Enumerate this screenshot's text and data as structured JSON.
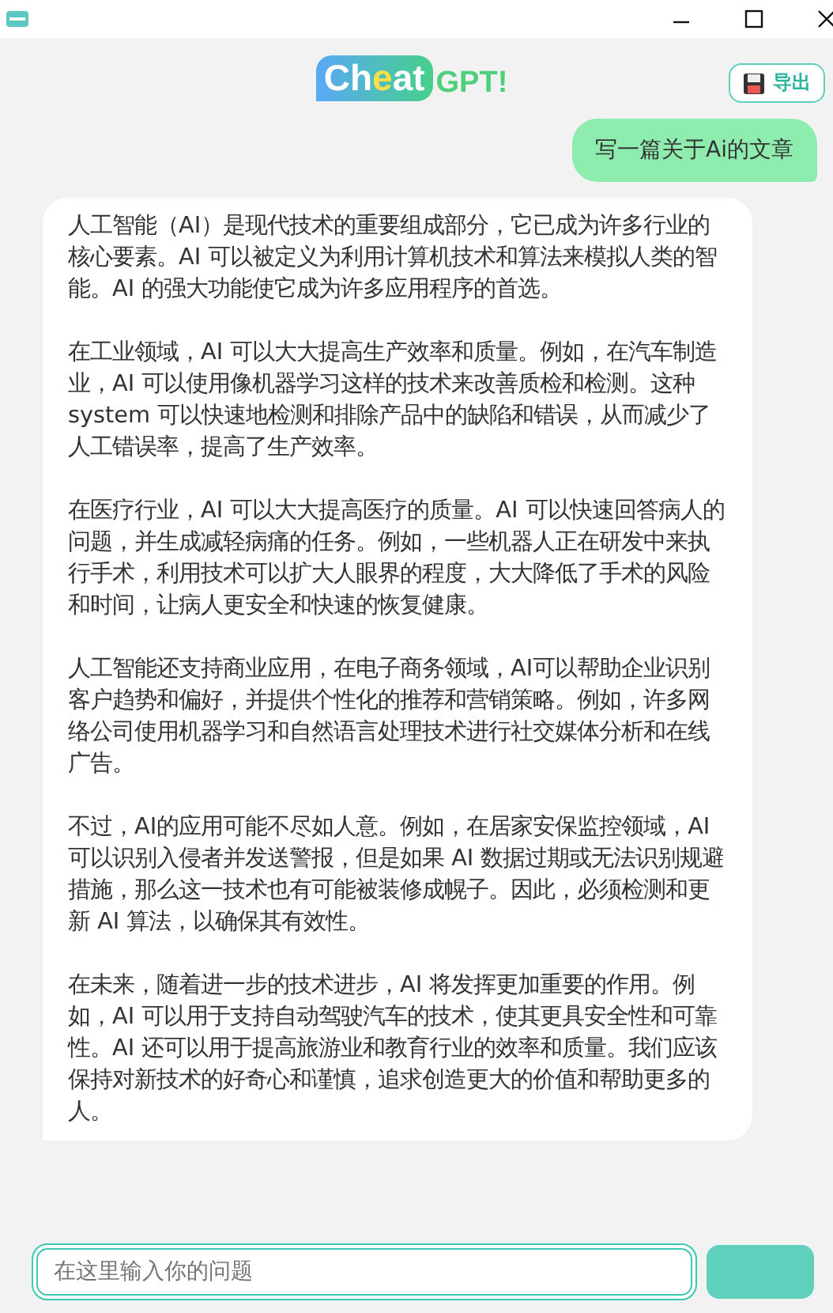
{
  "logo": {
    "segments": [
      {
        "text": "Ch",
        "color": "#ffffff"
      },
      {
        "text": "e",
        "color": "#f7e04a"
      },
      {
        "text": "at",
        "color": "#ffffff"
      }
    ],
    "suffix": "GPT!"
  },
  "export_button": {
    "label": "导出"
  },
  "messages": [
    {
      "kind": "user",
      "paragraphs": [
        "写一篇关于Ai的文章"
      ]
    },
    {
      "kind": "reply",
      "paragraphs": [
        "人工智能（AI）是现代技术的重要组成部分，它已成为许多行业的核心要素。AI 可以被定义为利用计算机技术和算法来模拟人类的智能。AI 的强大功能使它成为许多应用程序的首选。",
        "在工业领域，AI 可以大大提高生产效率和质量。例如，在汽车制造业，AI 可以使用像机器学习这样的技术来改善质检和检测。这种 system 可以快速地检测和排除产品中的缺陷和错误，从而减少了人工错误率，提高了生产效率。",
        "在医疗行业，AI 可以大大提高医疗的质量。AI 可以快速回答病人的问题，并生成减轻病痛的任务。例如，一些机器人正在研发中来执行手术，利用技术可以扩大人眼界的程度，大大降低了手术的风险和时间，让病人更安全和快速的恢复健康。",
        "人工智能还支持商业应用，在电子商务领域，AI可以帮助企业识别客户趋势和偏好，并提供个性化的推荐和营销策略。例如，许多网络公司使用机器学习和自然语言处理技术进行社交媒体分析和在线广告。",
        "不过，AI的应用可能不尽如人意。例如，在居家安保监控领域，AI 可以识别入侵者并发送警报，但是如果 AI 数据过期或无法识别规避措施，那么这一技术也有可能被装修成幌子。因此，必须检测和更新 AI 算法，以确保其有效性。",
        "在未来，随着进一步的技术进步，AI 将发挥更加重要的作用。例如，AI 可以用于支持自动驾驶汽车的技术，使其更具安全性和可靠性。AI 还可以用于提高旅游业和教育行业的效率和质量。我们应该保持对新技术的好奇心和谨慎，追求创造更大的价值和帮助更多的人。"
      ]
    }
  ],
  "input": {
    "placeholder": "在这里输入你的问题"
  }
}
